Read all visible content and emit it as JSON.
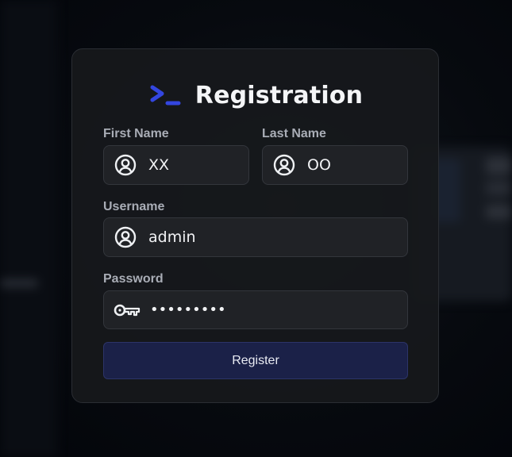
{
  "form": {
    "title": "Registration",
    "logo_icon": "terminal-prompt-icon",
    "accent_color": "#3346e0",
    "first_name": {
      "label": "First Name",
      "value": "XX",
      "icon": "user-circle-icon"
    },
    "last_name": {
      "label": "Last Name",
      "value": "OO",
      "icon": "user-circle-icon"
    },
    "username": {
      "label": "Username",
      "value": "admin",
      "icon": "user-circle-icon"
    },
    "password": {
      "label": "Password",
      "value": "•••••••••",
      "icon": "key-icon"
    },
    "submit_label": "Register",
    "submit_color": "#1b2148"
  }
}
